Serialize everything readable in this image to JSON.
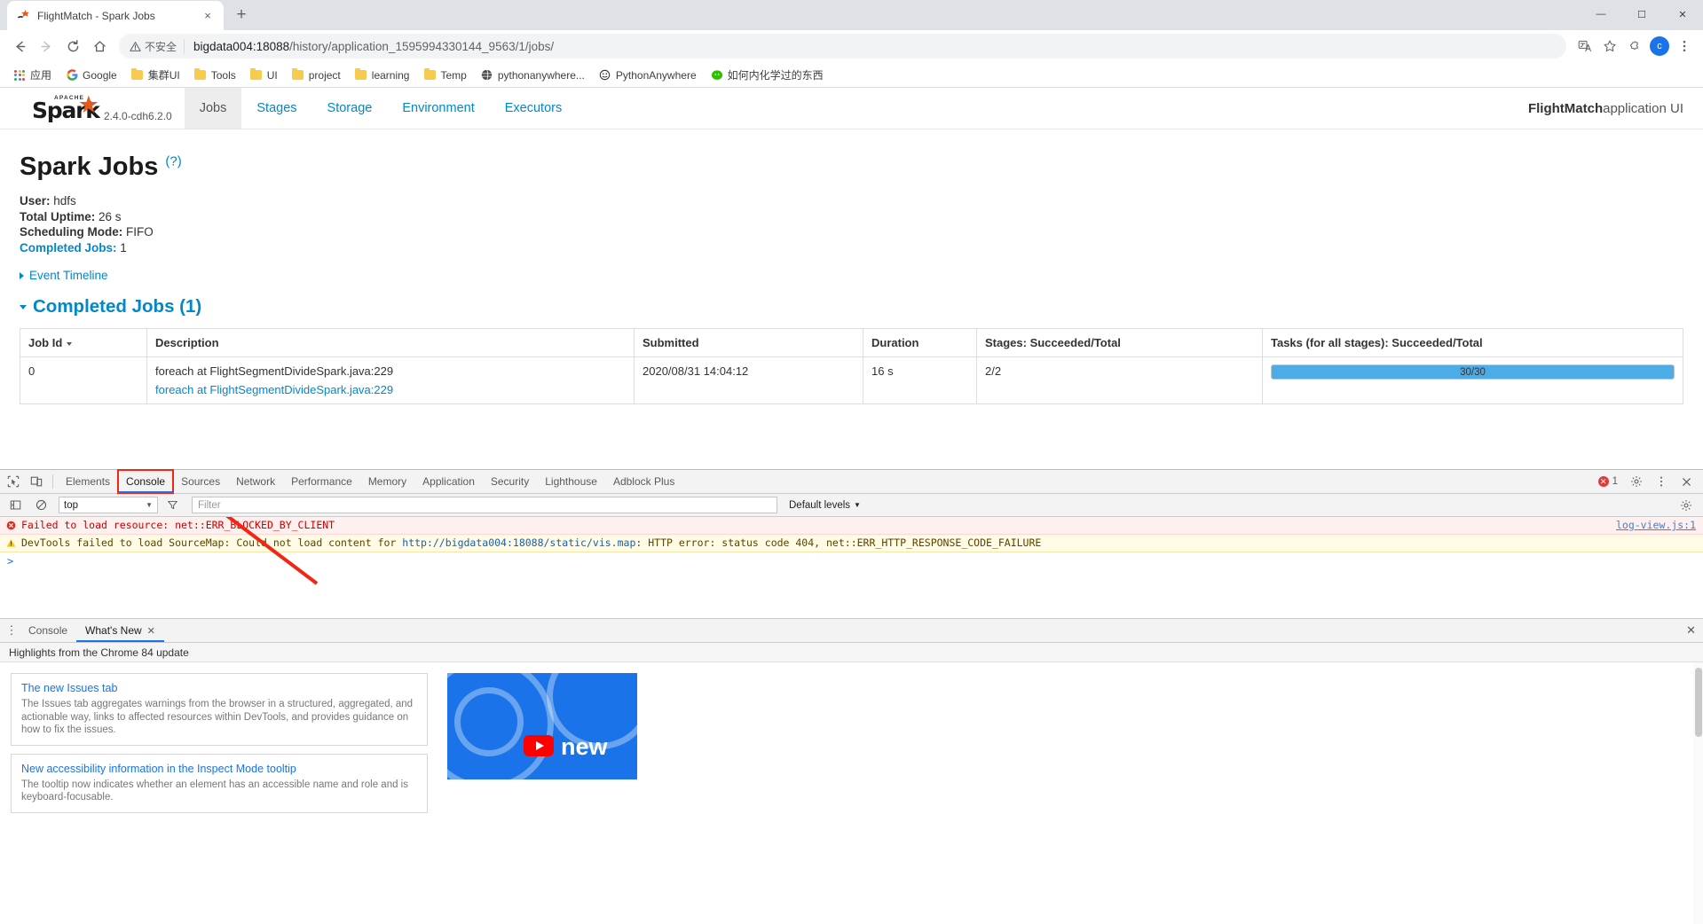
{
  "browser": {
    "tab": {
      "title": "FlightMatch - Spark Jobs",
      "favicon": "spark-icon",
      "close_label": "×"
    },
    "new_tab_label": "+",
    "window_controls": {
      "minimize": "—",
      "maximize": "☐",
      "close": "✕"
    },
    "nav": {
      "back": "←",
      "forward": "→",
      "reload": "↻",
      "home": "⌂"
    },
    "omnibox": {
      "security_label": "不安全",
      "url_host": "bigdata004:18088",
      "url_path": "/history/application_1595994330144_9563/1/jobs/"
    },
    "toolbar_icons": [
      "translate-icon",
      "bookmark-star-icon",
      "extension-puzzle-icon",
      "profile-avatar",
      "chrome-menu-icon"
    ],
    "profile_initial": "c",
    "bookmarks": [
      {
        "label": "应用",
        "icon": "apps-grid-icon"
      },
      {
        "label": "Google",
        "icon": "google-icon"
      },
      {
        "label": "集群UI",
        "icon": "folder-icon"
      },
      {
        "label": "Tools",
        "icon": "folder-icon"
      },
      {
        "label": "UI",
        "icon": "folder-icon"
      },
      {
        "label": "project",
        "icon": "folder-icon"
      },
      {
        "label": "learning",
        "icon": "folder-icon"
      },
      {
        "label": "Temp",
        "icon": "folder-icon"
      },
      {
        "label": "pythonanywhere...",
        "icon": "globe-icon"
      },
      {
        "label": "PythonAnywhere",
        "icon": "pythonanywhere-icon"
      },
      {
        "label": "如何内化学过的东西",
        "icon": "wechat-icon"
      }
    ]
  },
  "spark": {
    "version": "2.4.0-cdh6.2.0",
    "logo_word": "Spark",
    "logo_apache": "APACHE",
    "tabs": [
      {
        "label": "Jobs",
        "active": true
      },
      {
        "label": "Stages",
        "active": false
      },
      {
        "label": "Storage",
        "active": false
      },
      {
        "label": "Environment",
        "active": false
      },
      {
        "label": "Executors",
        "active": false
      }
    ],
    "app_name_bold": "FlightMatch",
    "app_name_rest": " application UI",
    "page_title": "Spark Jobs",
    "page_title_help": "(?)",
    "summary": [
      {
        "label": "User:",
        "value": "hdfs",
        "link": false
      },
      {
        "label": "Total Uptime:",
        "value": "26 s",
        "link": false
      },
      {
        "label": "Scheduling Mode:",
        "value": "FIFO",
        "link": false
      },
      {
        "label": "Completed Jobs:",
        "value": "1",
        "link": true
      }
    ],
    "event_timeline_label": "Event Timeline",
    "section_title": "Completed Jobs (1)",
    "table": {
      "columns": [
        "Job Id",
        "Description",
        "Submitted",
        "Duration",
        "Stages: Succeeded/Total",
        "Tasks (for all stages): Succeeded/Total"
      ],
      "rows": [
        {
          "job_id": "0",
          "description_plain": "foreach at FlightSegmentDivideSpark.java:229",
          "description_link": "foreach at FlightSegmentDivideSpark.java:229",
          "submitted": "2020/08/31 14:04:12",
          "duration": "16 s",
          "stages": "2/2",
          "tasks_text": "30/30",
          "tasks_percent": 100
        }
      ]
    }
  },
  "devtools": {
    "tabs": [
      {
        "label": "Elements",
        "active": false
      },
      {
        "label": "Console",
        "active": true,
        "highlighted": true
      },
      {
        "label": "Sources",
        "active": false
      },
      {
        "label": "Network",
        "active": false
      },
      {
        "label": "Performance",
        "active": false
      },
      {
        "label": "Memory",
        "active": false
      },
      {
        "label": "Application",
        "active": false
      },
      {
        "label": "Security",
        "active": false
      },
      {
        "label": "Lighthouse",
        "active": false
      },
      {
        "label": "Adblock Plus",
        "active": false
      }
    ],
    "error_count": "1",
    "filterbar": {
      "context": "top",
      "filter_placeholder": "Filter",
      "levels_label": "Default levels"
    },
    "console_messages": [
      {
        "level": "error",
        "icon": "error-icon",
        "text": "Failed to load resource: net::ERR_BLOCKED_BY_CLIENT",
        "source": "log-view.js:1"
      },
      {
        "level": "warn",
        "icon": "warning-icon",
        "text_before": "DevTools failed to load SourceMap: Could not load content for ",
        "link": "http://bigdata004:18088/static/vis.map",
        "text_after": ": HTTP error: status code 404, net::ERR_HTTP_RESPONSE_CODE_FAILURE",
        "source": ""
      }
    ],
    "prompt_symbol": ">",
    "drawer": {
      "tabs": [
        {
          "label": "Console",
          "active": false,
          "closable": false
        },
        {
          "label": "What's New",
          "active": true,
          "closable": true
        }
      ],
      "close_label": "✕",
      "subheader": "Highlights from the Chrome 84 update",
      "cards": [
        {
          "title": "The new Issues tab",
          "body": "The Issues tab aggregates warnings from the browser in a structured, aggregated, and actionable way, links to affected resources within DevTools, and provides guidance on how to fix the issues."
        },
        {
          "title": "New accessibility information in the Inspect Mode tooltip",
          "body": "The tooltip now indicates whether an element has an accessible name and role and is keyboard-focusable."
        }
      ],
      "video_caption": "new"
    }
  },
  "colors": {
    "spark_link": "#0088cc",
    "spark_orange": "#e25a1c",
    "devtools_accent": "#1a73e8",
    "annotation_red": "#f22613",
    "progress_blue": "#4dabe6"
  }
}
